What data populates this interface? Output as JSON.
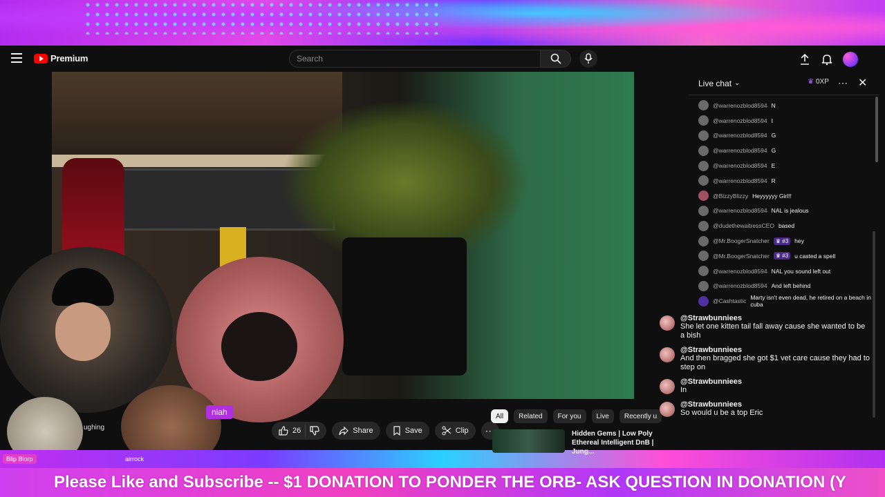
{
  "header": {
    "logo_text": "Premium",
    "search_placeholder": "Search"
  },
  "overlay": {
    "tag_left": "Blip Blorp",
    "tag_mid": "airrock",
    "tag_purple": "niah",
    "tag_laughing": "ughing",
    "ticker": "Please Like and Subscribe -- $1 DONATION TO PONDER THE ORB- ASK QUESTION IN DONATION (Y"
  },
  "actions": {
    "likes": "26",
    "share": "Share",
    "save": "Save",
    "clip": "Clip"
  },
  "chips": [
    "All",
    "Related",
    "For you",
    "Live",
    "Recently u"
  ],
  "recommendation": {
    "title": "Hidden Gems | Low Poly Ethereal Intelligent DnB | Jung..."
  },
  "chat": {
    "title": "Live chat",
    "xp": "0XP",
    "messages": [
      {
        "author": "@warrenozblod8594",
        "text": "N",
        "badge": ""
      },
      {
        "author": "@warrenozblod8594",
        "text": "I",
        "badge": ""
      },
      {
        "author": "@warrenozblod8594",
        "text": "G",
        "badge": ""
      },
      {
        "author": "@warrenozblod8594",
        "text": "G",
        "badge": ""
      },
      {
        "author": "@warrenozblod8594",
        "text": "E",
        "badge": ""
      },
      {
        "author": "@warrenozblod8594",
        "text": "R",
        "badge": ""
      },
      {
        "author": "@BizzyBlizzy",
        "text": "Heyyyyyy Girl!!",
        "badge": ""
      },
      {
        "author": "@warrenozblod8594",
        "text": "NAL is jealous",
        "badge": ""
      },
      {
        "author": "@dudethewaitressCEO",
        "text": "based",
        "badge": ""
      },
      {
        "author": "@Mr.BoogerSnatcher",
        "text": "hey",
        "badge": "#3"
      },
      {
        "author": "@Mr.BoogerSnatcher",
        "text": "u casted a spell",
        "badge": "#3"
      },
      {
        "author": "@warrenozblod8594",
        "text": "NAL you sound left out",
        "badge": ""
      },
      {
        "author": "@warrenozblod8594",
        "text": "And left behind",
        "badge": ""
      },
      {
        "author": "@Cashtastic",
        "text": "Marty isn't even dead, he retired on a beach in cuba",
        "badge": ""
      }
    ]
  },
  "comments": [
    {
      "author": "@Strawbunniees",
      "text": "She let one kitten tail fall away cause she wanted to be a bish"
    },
    {
      "author": "@Strawbunniees",
      "text": "And then bragged she got $1 vet care cause they had to step on"
    },
    {
      "author": "@Strawbunniees",
      "text": "In"
    },
    {
      "author": "@Strawbunniees",
      "text": "So would u be a top Eric"
    }
  ]
}
